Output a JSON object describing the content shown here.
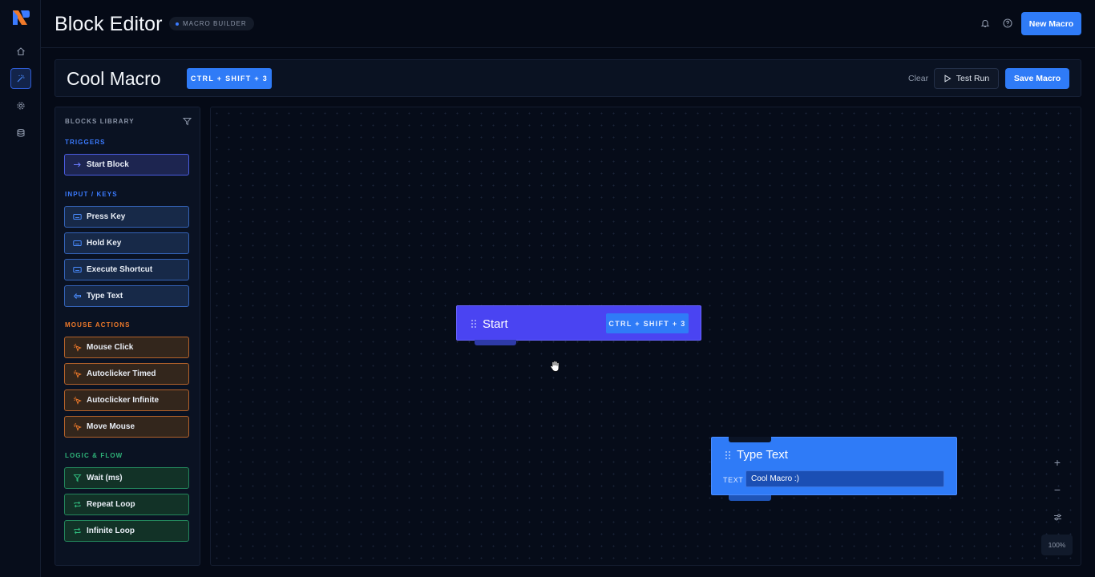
{
  "header": {
    "title": "Block Editor",
    "badge": "MACRO BUILDER",
    "new_macro_label": "New Macro"
  },
  "rail": {
    "items": [
      "home-icon",
      "wand-icon",
      "gear-icon",
      "database-icon"
    ],
    "active": "wand-icon"
  },
  "macro": {
    "name": "Cool Macro",
    "shortcut": "CTRL + SHIFT + 3",
    "clear_label": "Clear",
    "test_run_label": "Test Run",
    "save_label": "Save Macro"
  },
  "library": {
    "title": "BLOCKS LIBRARY",
    "categories": [
      {
        "name": "TRIGGERS",
        "color": "#3b7bff",
        "items": [
          "Start Block"
        ]
      },
      {
        "name": "INPUT / KEYS",
        "color": "#3b7bff",
        "items": [
          "Press Key",
          "Hold Key",
          "Execute Shortcut",
          "Type Text"
        ]
      },
      {
        "name": "MOUSE ACTIONS",
        "color": "#f07a2a",
        "items": [
          "Mouse Click",
          "Autoclicker Timed",
          "Autoclicker Infinite",
          "Move Mouse"
        ]
      },
      {
        "name": "LOGIC & FLOW",
        "color": "#2fb57a",
        "items": [
          "Wait (ms)",
          "Repeat Loop",
          "Infinite Loop"
        ]
      }
    ]
  },
  "canvas": {
    "start_node": {
      "title": "Start",
      "shortcut": "CTRL + SHIFT + 3"
    },
    "type_text_node": {
      "title": "Type Text",
      "field_label": "TEXT",
      "field_value": "Cool Macro :)"
    },
    "zoom": {
      "in": "+",
      "out": "−",
      "level": "100%"
    }
  },
  "colors": {
    "accent": "#2f7bf7",
    "start_node": "#4a44f2",
    "trigger": "#4a5ce0",
    "mouse": "#b4622a",
    "logic": "#23865c"
  }
}
